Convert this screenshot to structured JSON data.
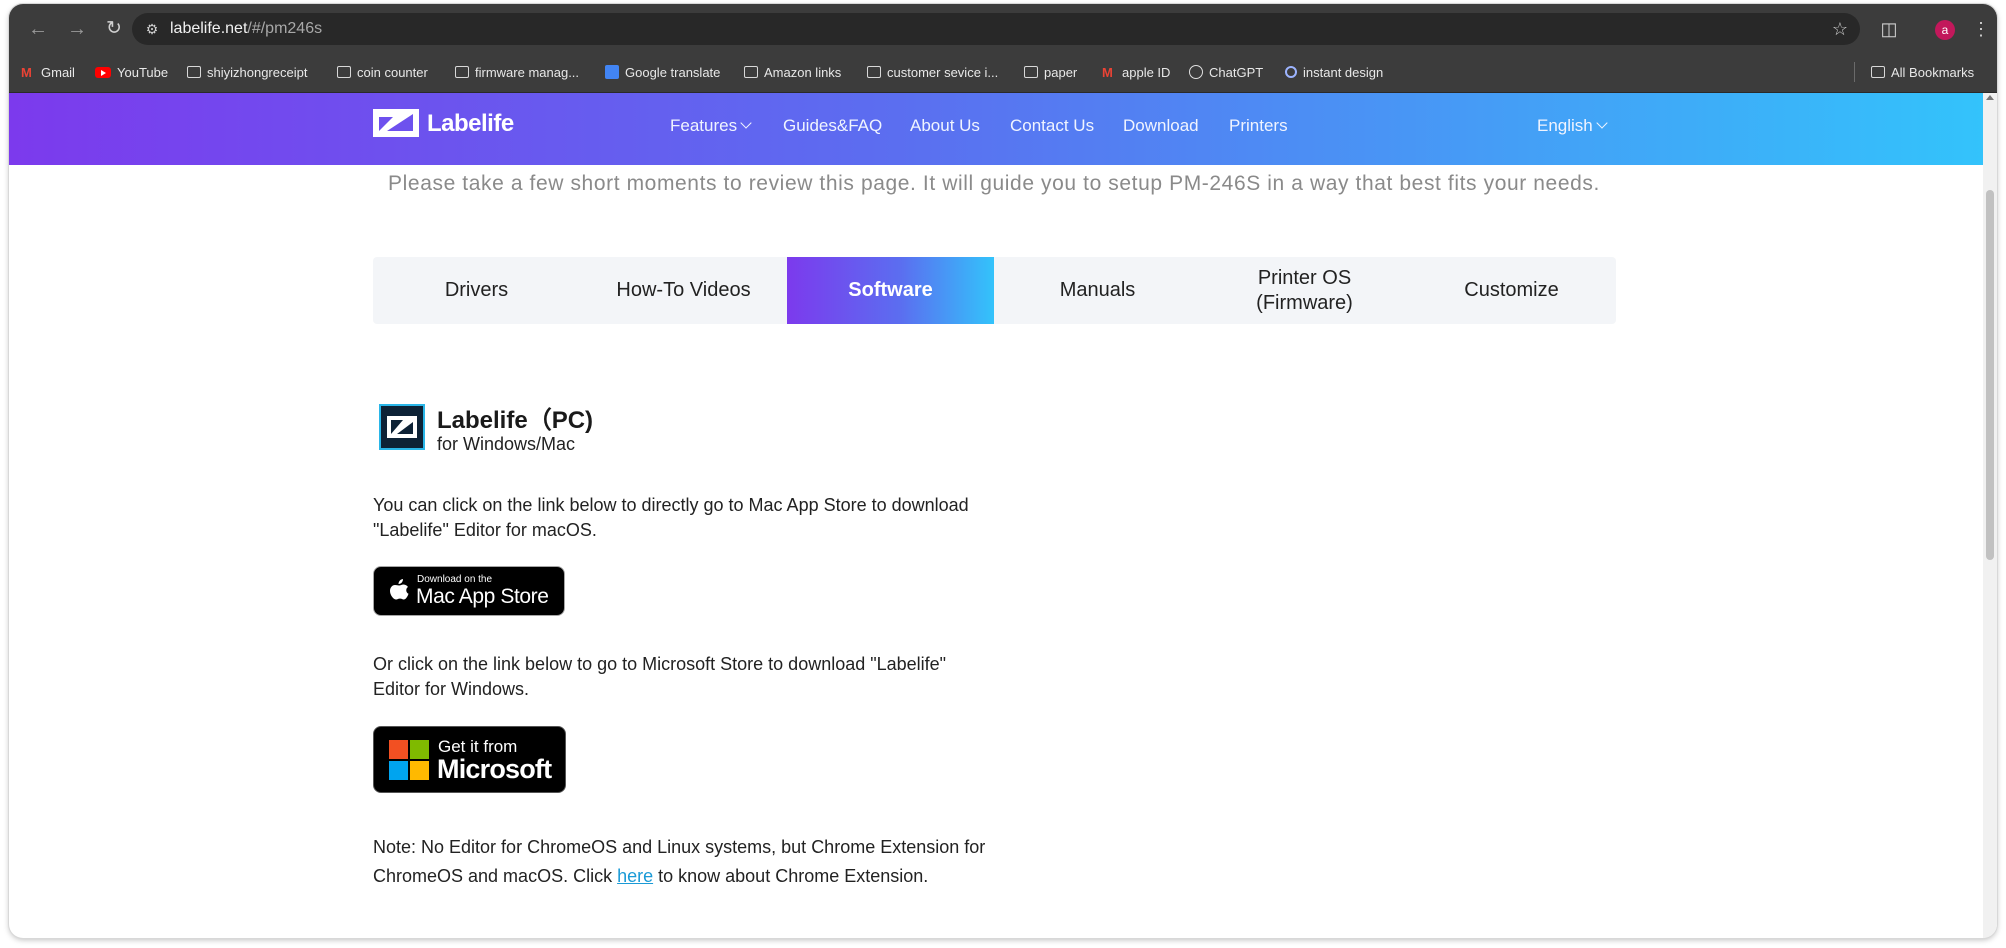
{
  "browser": {
    "url_host": "labelife.net",
    "url_path": "/#/pm246s",
    "profile_initial": "a",
    "bookmarks": [
      {
        "label": "Gmail",
        "icon": "gmail-icon"
      },
      {
        "label": "YouTube",
        "icon": "youtube-icon"
      },
      {
        "label": "shiyizhongreceipt",
        "icon": "folder-icon"
      },
      {
        "label": "coin counter",
        "icon": "folder-icon"
      },
      {
        "label": "firmware manag...",
        "icon": "folder-icon"
      },
      {
        "label": "Google translate",
        "icon": "google-translate-icon"
      },
      {
        "label": "Amazon links",
        "icon": "folder-icon"
      },
      {
        "label": "customer sevice i...",
        "icon": "folder-icon"
      },
      {
        "label": "paper",
        "icon": "folder-icon"
      },
      {
        "label": "apple ID",
        "icon": "gmail-icon"
      },
      {
        "label": "ChatGPT",
        "icon": "chatgpt-icon"
      },
      {
        "label": "instant design",
        "icon": "instant-design-icon"
      }
    ],
    "all_bookmarks": "All Bookmarks"
  },
  "site": {
    "logo_text": "Labelife",
    "nav": {
      "features": "Features",
      "guides": "Guides&FAQ",
      "about": "About Us",
      "contact": "Contact Us",
      "download": "Download",
      "printers": "Printers"
    },
    "language": "English",
    "colors": {
      "gradient_start": "#7c3aed",
      "gradient_end": "#33c3fb"
    }
  },
  "content": {
    "intro": "Please take a few short moments to review this page. It will guide you to setup PM-246S in a way that best fits your needs.",
    "tabs": {
      "drivers": "Drivers",
      "videos": "How-To Videos",
      "software": "Software",
      "manuals": "Manuals",
      "firmware_1": "Printer OS",
      "firmware_2": "(Firmware)",
      "customize": "Customize"
    },
    "active_tab": "Software",
    "app_title": "Labelife（PC)",
    "app_subtitle": "for Windows/Mac",
    "mac_text": "You can click on the link below to directly go to Mac App Store to download \"Labelife\" Editor for macOS.",
    "mac_badge_small": "Download on the",
    "mac_badge_big": "Mac App Store",
    "win_text": "Or click on the link below to go to Microsoft Store to download \"Labelife\" Editor for Windows.",
    "ms_badge_small": "Get it from",
    "ms_badge_big": "Microsoft",
    "note_before": "Note: No Editor for ChromeOS and Linux systems, but Chrome Extension for ChromeOS and macOS. Click ",
    "note_link": "here",
    "note_after": " to know about Chrome Extension."
  }
}
